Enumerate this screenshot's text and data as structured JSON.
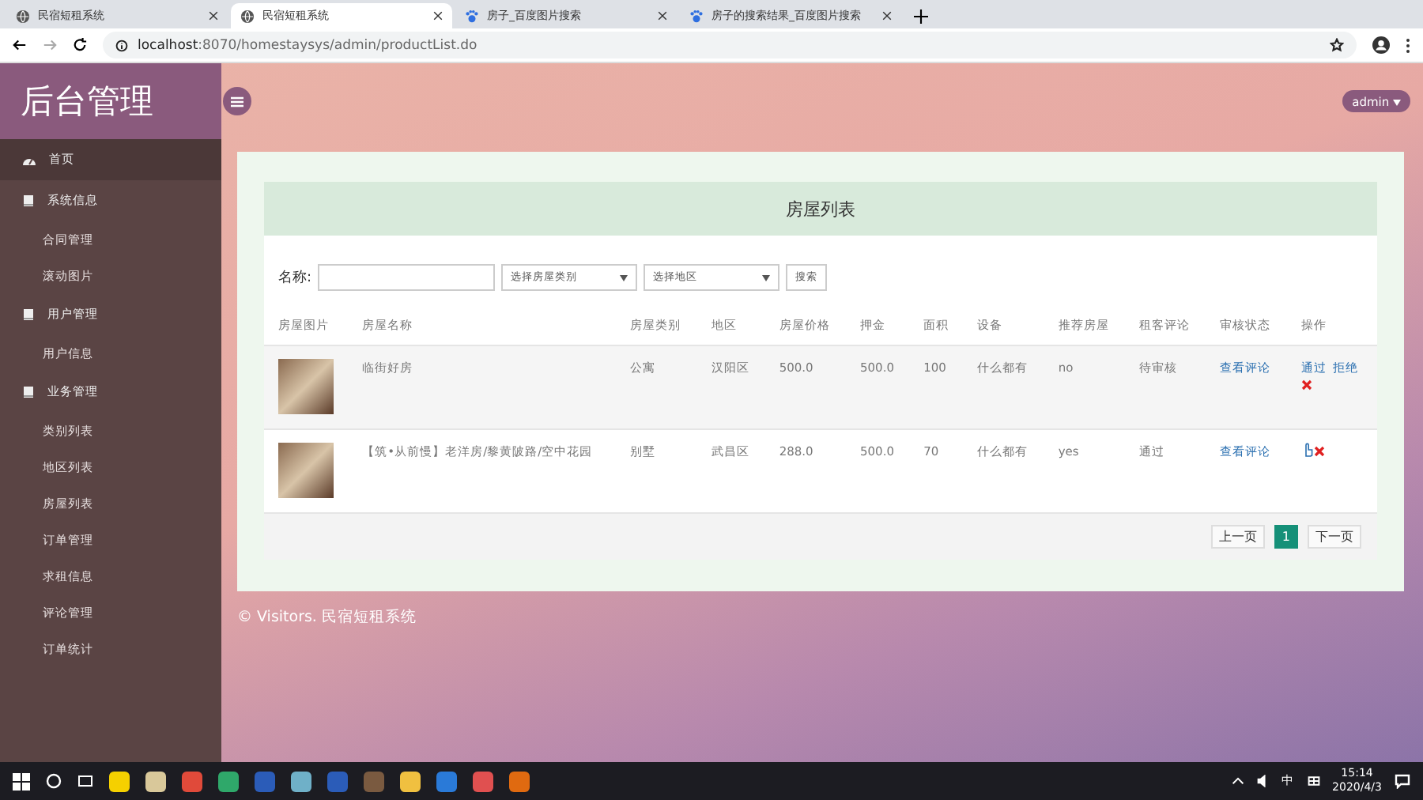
{
  "browser": {
    "tabs": [
      {
        "title": "民宿短租系统",
        "selected": false,
        "kind": "globe"
      },
      {
        "title": "民宿短租系统",
        "selected": true,
        "kind": "globe"
      },
      {
        "title": "房子_百度图片搜索",
        "selected": false,
        "kind": "paw"
      },
      {
        "title": "房子的搜索结果_百度图片搜索",
        "selected": false,
        "kind": "paw"
      }
    ],
    "url_host": "localhost",
    "url_rest": ":8070/homestaysys/admin/productList.do"
  },
  "sidebar": {
    "title": "后台管理",
    "items": [
      {
        "label": "首页",
        "kind": "home",
        "selected": true
      },
      {
        "label": "系统信息",
        "kind": "group",
        "selected": false,
        "children": [
          {
            "label": "合同管理"
          },
          {
            "label": "滚动图片"
          }
        ]
      },
      {
        "label": "用户管理",
        "kind": "group",
        "selected": false,
        "children": [
          {
            "label": "用户信息"
          }
        ]
      },
      {
        "label": "业务管理",
        "kind": "group",
        "selected": false,
        "children": [
          {
            "label": "类别列表"
          },
          {
            "label": "地区列表"
          },
          {
            "label": "房屋列表"
          },
          {
            "label": "订单管理"
          },
          {
            "label": "求租信息"
          },
          {
            "label": "评论管理"
          },
          {
            "label": "订单统计"
          }
        ]
      }
    ]
  },
  "user_menu": {
    "label": "admin"
  },
  "panel": {
    "title": "房屋列表",
    "search": {
      "label": "名称:",
      "type_select": "选择房屋类别",
      "area_select": "选择地区",
      "button": "搜索"
    },
    "table": {
      "columns": [
        "房屋图片",
        "房屋名称",
        "房屋类别",
        "地区",
        "房屋价格",
        "押金",
        "面积",
        "设备",
        "推荐房屋",
        "租客评论",
        "审核状态",
        "操作"
      ],
      "rows": [
        {
          "name": "临街好房",
          "type": "公寓",
          "area": "汉阳区",
          "price": "500.0",
          "deposit": "500.0",
          "size": "100",
          "facilities": "什么都有",
          "recommended": "no",
          "review_status": "待审核",
          "comments_link": "查看评论",
          "actions": [
            {
              "kind": "link",
              "label": "通过"
            },
            {
              "kind": "link",
              "label": "拒绝"
            },
            {
              "kind": "delete"
            }
          ]
        },
        {
          "name": "【筑•从前慢】老洋房/黎黄陂路/空中花园",
          "type": "别墅",
          "area": "武昌区",
          "price": "288.0",
          "deposit": "500.0",
          "size": "70",
          "facilities": "什么都有",
          "recommended": "yes",
          "review_status": "通过",
          "comments_link": "查看评论",
          "actions": [
            {
              "kind": "approve"
            },
            {
              "kind": "delete"
            }
          ]
        }
      ]
    },
    "pagination": {
      "prev": "上一页",
      "pages": [
        {
          "label": "1",
          "selected": true
        }
      ],
      "next": "下一页"
    }
  },
  "footer": "© Visitors. 民宿短租系统",
  "taskbar": {
    "ime": "中",
    "time": "15:14",
    "date": "2020/4/3"
  }
}
